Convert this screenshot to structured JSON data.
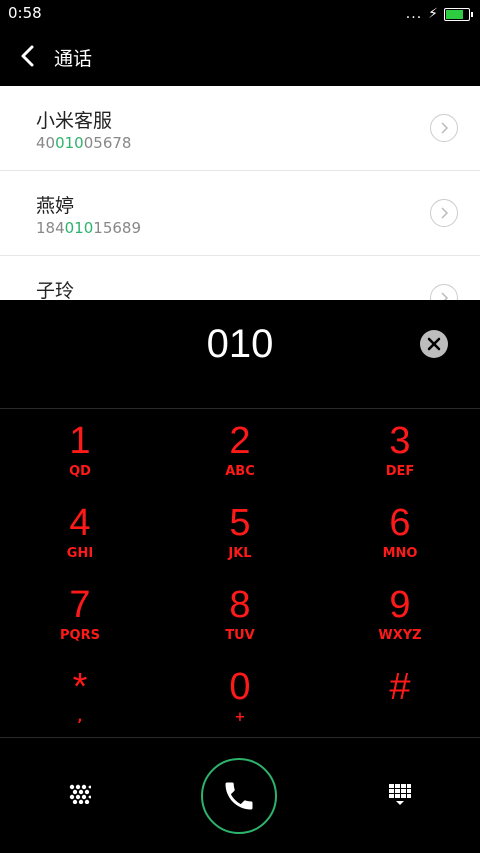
{
  "status_bar": {
    "time": "0:58",
    "dots": "...",
    "battery_color": "#2ecc40"
  },
  "header": {
    "title": "通话",
    "back_icon": "chevron-left-icon"
  },
  "contacts": [
    {
      "name": "小米客服",
      "number_prefix": "40",
      "number_match": "010",
      "number_suffix": "05678"
    },
    {
      "name": "燕婷",
      "number_prefix": "184",
      "number_match": "010",
      "number_suffix": "15689"
    },
    {
      "name": "子玲",
      "number_prefix": "",
      "number_match": "",
      "number_suffix": ""
    }
  ],
  "dialer": {
    "number": "010",
    "clear_icon": "clear-icon"
  },
  "keys": [
    {
      "digit": "1",
      "letters": "QD"
    },
    {
      "digit": "2",
      "letters": "ABC"
    },
    {
      "digit": "3",
      "letters": "DEF"
    },
    {
      "digit": "4",
      "letters": "GHI"
    },
    {
      "digit": "5",
      "letters": "JKL"
    },
    {
      "digit": "6",
      "letters": "MNO"
    },
    {
      "digit": "7",
      "letters": "PQRS"
    },
    {
      "digit": "8",
      "letters": "TUV"
    },
    {
      "digit": "9",
      "letters": "WXYZ"
    },
    {
      "digit": "*",
      "letters": ","
    },
    {
      "digit": "0",
      "letters": "+"
    },
    {
      "digit": "#",
      "letters": ""
    }
  ],
  "colors": {
    "accent_green": "#2db36b",
    "key_red": "#ff1a1a"
  },
  "bottom": {
    "left_icon": "dots-grid-icon",
    "call_icon": "phone-icon",
    "right_icon": "keypad-hide-icon"
  }
}
